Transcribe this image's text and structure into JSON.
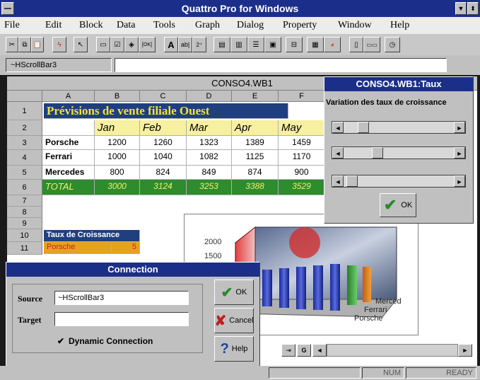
{
  "app": {
    "title": "Quattro Pro for Windows"
  },
  "menu": {
    "items": [
      "File",
      "Edit",
      "Block",
      "Data",
      "Tools",
      "Graph",
      "Dialog",
      "Property",
      "Window",
      "Help"
    ]
  },
  "inputline": {
    "cell_name": "~HScrollBar3"
  },
  "sheet": {
    "title": "CONSO4.WB1",
    "columns": [
      "A",
      "B",
      "C",
      "D",
      "E",
      "F"
    ],
    "rows": [
      "1",
      "2",
      "3",
      "4",
      "5",
      "6",
      "7",
      "8",
      "9",
      "10",
      "11"
    ],
    "heading": "Prévisions de vente filiale Ouest",
    "months": [
      "Jan",
      "Feb",
      "Mar",
      "Apr",
      "May"
    ],
    "data_rows": [
      {
        "label": "Porsche",
        "values": [
          "1200",
          "1260",
          "1323",
          "1389",
          "1459"
        ]
      },
      {
        "label": "Ferrari",
        "values": [
          "1000",
          "1040",
          "1082",
          "1125",
          "1170"
        ]
      },
      {
        "label": "Mercedes",
        "values": [
          "800",
          "824",
          "849",
          "874",
          "900"
        ]
      }
    ],
    "total": {
      "label": "TOTAL",
      "values": [
        "3000",
        "3124",
        "3253",
        "3388",
        "3529"
      ]
    },
    "taux_label": "Taux de Croissance",
    "taux_porsche_label": "Porsche",
    "taux_porsche_value": "5"
  },
  "taux_dialog": {
    "title": "CONSO4.WB1:Taux",
    "caption": "Variation des taux de croissance",
    "ok_label": "OK"
  },
  "chart": {
    "y_ticks": [
      "2000",
      "1500"
    ],
    "series_labels": [
      "Merced",
      "Ferrari",
      "Porsche"
    ]
  },
  "connection_dialog": {
    "title": "Connection",
    "source_label": "Source",
    "source_value": "~HScrollBar3",
    "target_label": "Target",
    "target_value": "",
    "dynamic_label": "Dynamic Connection",
    "dynamic_checked": true,
    "ok_label": "OK",
    "cancel_label": "Cancel",
    "help_label": "Help"
  },
  "status": {
    "num": "NUM",
    "ready": "READY"
  },
  "colors": {
    "title_bar": "#1b2f8a",
    "heading_bg": "#1f3f7f",
    "heading_text": "#f2e23a",
    "month_bg": "#f7f0a0",
    "total_bg": "#2e8b2e",
    "taux_bg": "#1f3f7f",
    "porsche_bg": "#e8a020",
    "porsche_text": "#d02020"
  }
}
